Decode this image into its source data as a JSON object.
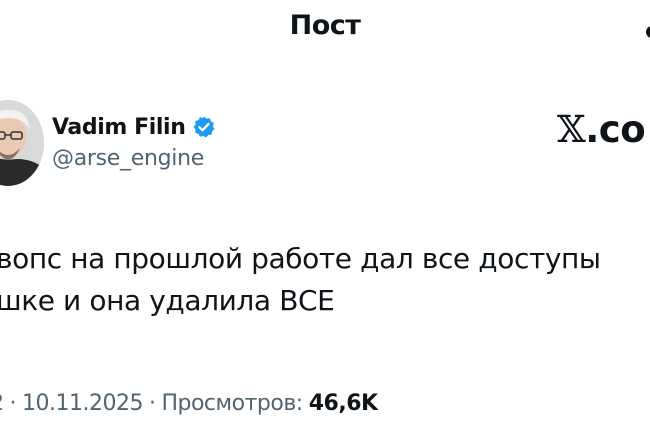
{
  "header": {
    "title": "Пост"
  },
  "author": {
    "name": "Vadim Filin",
    "handle": "@arse_engine",
    "verified_color": "#1d9bf0"
  },
  "watermark": {
    "x_glyph": "𝕏",
    "text": ".co"
  },
  "post": {
    "line1": "вопс на прошлой работе дал все доступы",
    "line2": "шке и она удалила ВСЕ"
  },
  "meta": {
    "time_fragment": "2",
    "separator": "·",
    "date": "10.11.2025",
    "views_label": "Просмотров:",
    "views_count": "46,6K"
  },
  "colors": {
    "text_primary": "#0f1419",
    "text_secondary": "#536471",
    "accent": "#1d9bf0"
  }
}
